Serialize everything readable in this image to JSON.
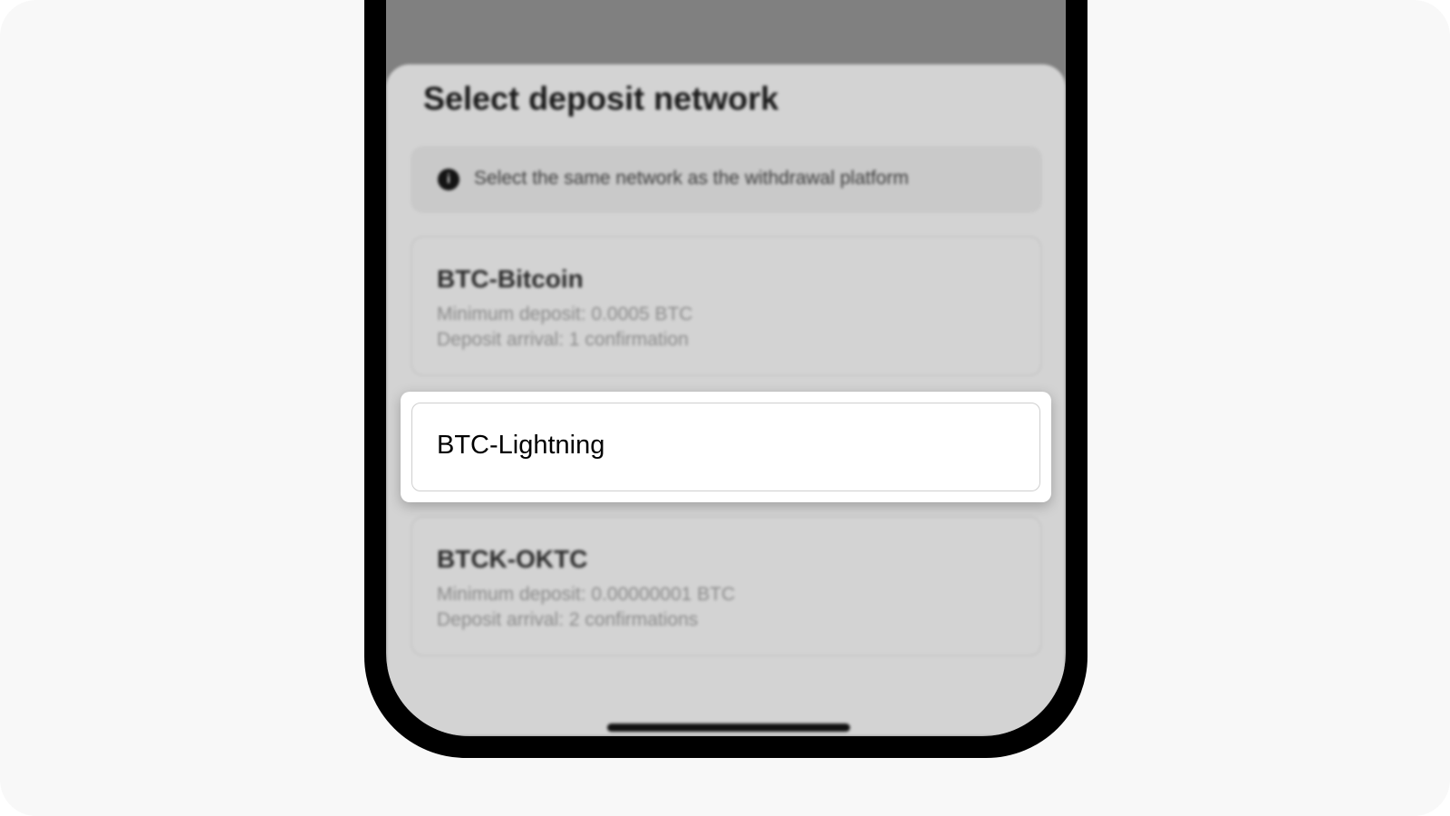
{
  "sheet": {
    "title": "Select deposit network",
    "notice": "Select the same network as the withdrawal platform",
    "notice_icon": "info-icon"
  },
  "networks": [
    {
      "name": "BTC-Bitcoin",
      "min_deposit": "Minimum deposit: 0.0005 BTC",
      "arrival": "Deposit arrival: 1 confirmation"
    },
    {
      "name": "BTC-Lightning"
    },
    {
      "name": "BTCK-OKTC",
      "min_deposit": "Minimum deposit: 0.00000001 BTC",
      "arrival": "Deposit arrival: 2 confirmations"
    }
  ],
  "colors": {
    "stage_background": "#f8f8f8",
    "phone_frame": "#000000",
    "overlay_dim": "#808080",
    "sheet_background": "#d3d3d3",
    "highlight_background": "#ffffff"
  }
}
